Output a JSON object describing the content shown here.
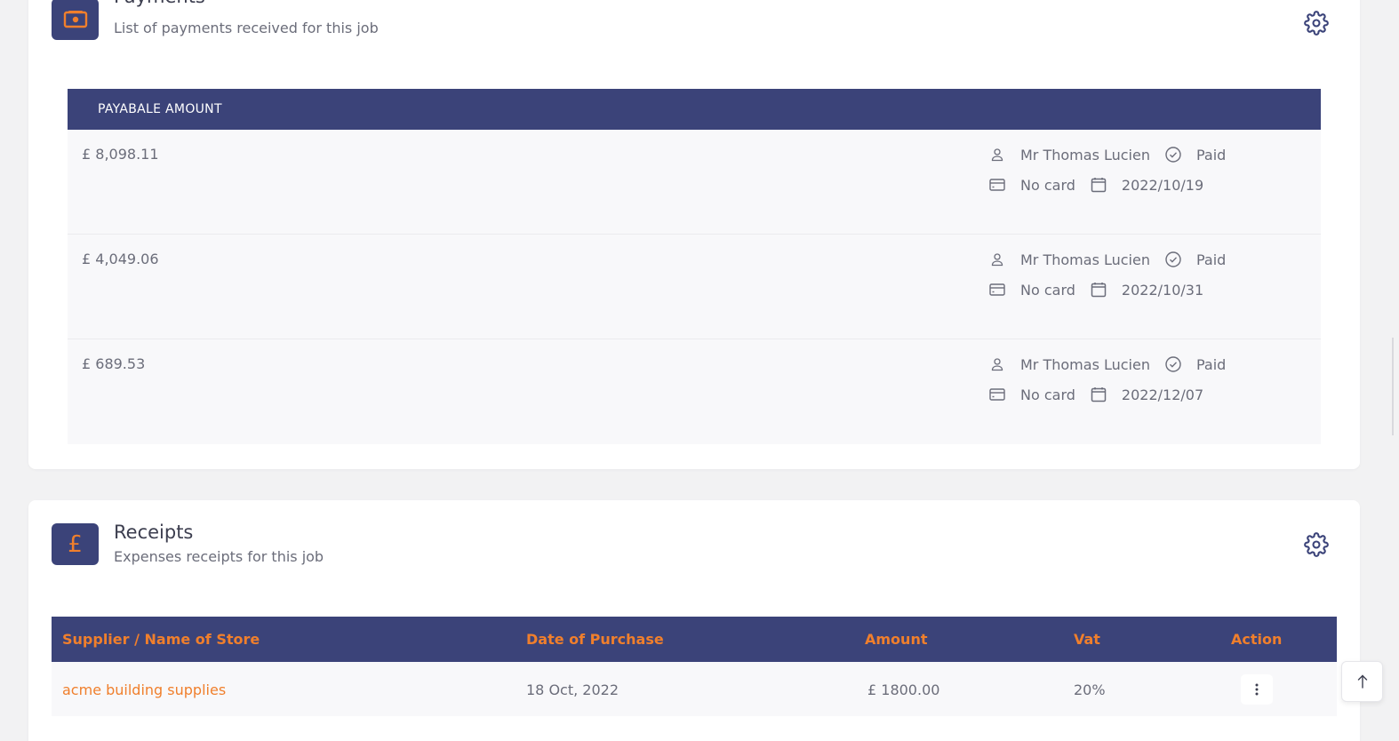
{
  "payments": {
    "title": "Payments",
    "subtitle": "List of payments received for this job",
    "column_header": "PAYABALE AMOUNT",
    "rows": [
      {
        "amount": "£ 8,098.11",
        "customer": "Mr Thomas Lucien",
        "status": "Paid",
        "card": "No card",
        "date": "2022/10/19"
      },
      {
        "amount": "£ 4,049.06",
        "customer": "Mr Thomas Lucien",
        "status": "Paid",
        "card": "No card",
        "date": "2022/10/31"
      },
      {
        "amount": "£ 689.53",
        "customer": "Mr Thomas Lucien",
        "status": "Paid",
        "card": "No card",
        "date": "2022/12/07"
      }
    ]
  },
  "receipts": {
    "title": "Receipts",
    "subtitle": "Expenses receipts for this job",
    "icon_glyph": "£",
    "columns": {
      "supplier": "Supplier / Name of Store",
      "date": "Date of Purchase",
      "amount": "Amount",
      "vat": "Vat",
      "action": "Action"
    },
    "rows": [
      {
        "supplier": "acme building supplies",
        "date": "18 Oct, 2022",
        "amount": "£ 1800.00",
        "vat": "20%"
      }
    ]
  },
  "colors": {
    "accent": "#f07f2c",
    "header_bg": "#3b4379",
    "row_bg": "#f8f8fa",
    "page_bg": "#f2f2f3"
  },
  "icons": {
    "payments": "money-icon",
    "receipts": "pound-icon",
    "settings": "gear-icon",
    "user": "user-icon",
    "status": "check-circle-icon",
    "card": "credit-card-icon",
    "date": "calendar-icon",
    "action": "kebab-menu-icon",
    "scroll": "arrow-up-icon"
  }
}
